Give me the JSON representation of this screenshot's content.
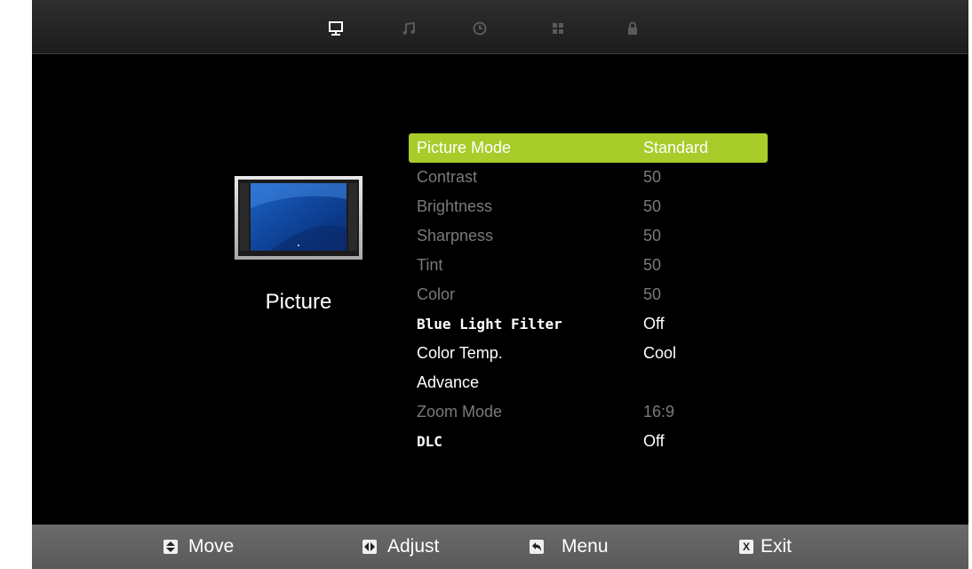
{
  "category": {
    "title": "Picture"
  },
  "tabs": [
    {
      "name": "picture",
      "icon": "monitor-icon",
      "selected": true
    },
    {
      "name": "sound",
      "icon": "music-note-icon"
    },
    {
      "name": "time",
      "icon": "clock-icon"
    },
    {
      "name": "setup",
      "icon": "grid-icon"
    },
    {
      "name": "lock",
      "icon": "lock-icon"
    }
  ],
  "menu": {
    "items": [
      {
        "label": "Picture Mode",
        "value": "Standard",
        "state": "selected"
      },
      {
        "label": "Contrast",
        "value": "50",
        "state": "dim"
      },
      {
        "label": "Brightness",
        "value": "50",
        "state": "dim"
      },
      {
        "label": "Sharpness",
        "value": "50",
        "state": "dim"
      },
      {
        "label": "Tint",
        "value": "50",
        "state": "dim"
      },
      {
        "label": "Color",
        "value": "50",
        "state": "dim"
      },
      {
        "label": "Blue Light Filter",
        "value": "Off",
        "state": "active"
      },
      {
        "label": "Color Temp.",
        "value": "Cool",
        "state": "active"
      },
      {
        "label": "Advance",
        "value": "",
        "state": "active"
      },
      {
        "label": "Zoom Mode",
        "value": "16:9",
        "state": "dim"
      },
      {
        "label": "DLC",
        "value": "Off",
        "state": "active"
      }
    ]
  },
  "footer": {
    "move": {
      "label": "Move",
      "icon": "up-down-arrows-icon"
    },
    "adjust": {
      "label": "Adjust",
      "icon": "left-right-arrows-icon"
    },
    "menu": {
      "label": "Menu",
      "icon": "return-icon"
    },
    "exit": {
      "label": "Exit",
      "icon": "x-key-icon",
      "key": "X"
    }
  },
  "colors": {
    "highlight": "#a8cc2a",
    "background": "#000000",
    "footer": "#636363",
    "dim_text": "#7a7a7a"
  }
}
